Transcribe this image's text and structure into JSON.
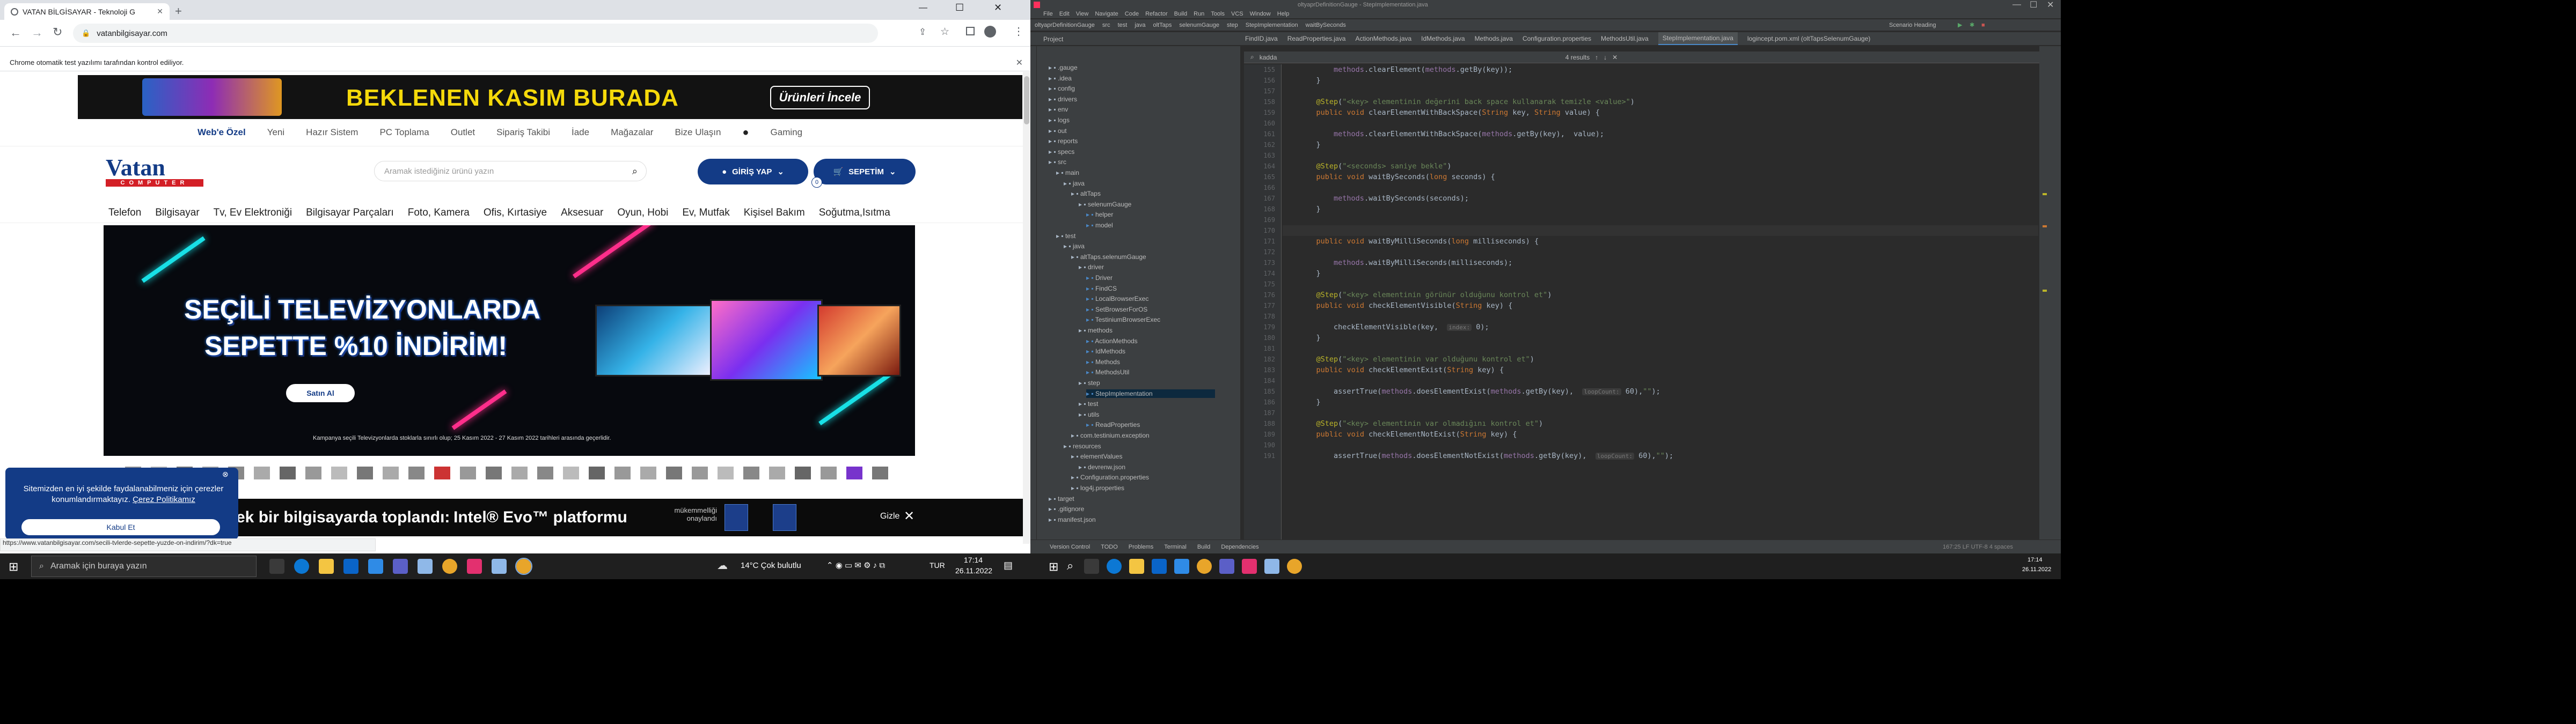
{
  "browser": {
    "tab_title": "VATAN BİLGİSAYAR - Teknoloji G",
    "url": "vatanbilgisayar.com",
    "infobar_text": "Chrome otomatik test yazılımı tarafından kontrol ediliyor.",
    "status_url": "https://www.vatanbilgisayar.com/secili-tvlerde-sepette-yuzde-on-indirim/?dk=true"
  },
  "site": {
    "top_banner_text": "BEKLENEN KASIM BURADA",
    "top_banner_button": "Ürünleri İncele",
    "top_nav": [
      "Web'e Özel",
      "Yeni",
      "Hazır Sistem",
      "PC Toplama",
      "Outlet",
      "Sipariş Takibi",
      "İade",
      "Mağazalar",
      "Bize Ulaşın",
      "Gaming"
    ],
    "logo_text": "Vatan",
    "logo_sub": "COMPUTER",
    "search_placeholder": "Aramak istediğiniz ürünü yazın",
    "login_label": "GİRİŞ YAP",
    "cart_label": "SEPETİM",
    "cart_count": "0",
    "categories": [
      "Telefon",
      "Bilgisayar",
      "Tv, Ev Elektroniği",
      "Bilgisayar Parçaları",
      "Foto, Kamera",
      "Ofis, Kırtasiye",
      "Aksesuar",
      "Oyun, Hobi",
      "Ev, Mutfak",
      "Kişisel Bakım",
      "Soğutma,Isıtma"
    ],
    "hero_line1": "SEÇİLİ TELEVİZYONLARDA",
    "hero_line2": "SEPETTE %10 İNDİRİM!",
    "hero_button": "Satın Al",
    "hero_footnote": "Kampanya seçili Televizyonlarda stoklarla sınırlı olup; 25 Kasım 2022 - 27 Kasım 2022 tarihleri arasında geçerlidir.",
    "cookie_text": "Sitemizden en iyi şekilde faydalanabilmeniz için çerezler konumlandırmaktayız.",
    "cookie_link": "Çerez Politikamız",
    "cookie_button": "Kabul Et",
    "intel_text_pre": "ek bir bilgisayarda toplandı:",
    "intel_text_brand": "Intel® Evo™ platformu",
    "intel_sub": "mükemmelliği onaylandı",
    "intel_close": "Gizle"
  },
  "ide": {
    "title": "oltyaprDefinitionGauge - StepImplementation.java",
    "menu": [
      "File",
      "Edit",
      "View",
      "Navigate",
      "Code",
      "Refactor",
      "Build",
      "Run",
      "Tools",
      "VCS",
      "Window",
      "Help"
    ],
    "breadcrumb": [
      "oltyaprDefinitionGauge",
      "src",
      "test",
      "java",
      "oltTaps",
      "selenumGauge",
      "step",
      "StepImplementation",
      "waitBySeconds"
    ],
    "run_config": "Scenario Heading",
    "tabs": [
      "FindID.java",
      "ReadProperties.java",
      "ActionMethods.java",
      "IdMethods.java",
      "Methods.java",
      "Configuration.properties",
      "MethodsUtil.java",
      "StepImplementation.java",
      "logincept.pom.xml (oltTapsSelenumGauge)"
    ],
    "find_text": "kadda",
    "find_count": "4 results",
    "project_label": "Project",
    "tree": [
      {
        "t": ".gauge",
        "d": 1
      },
      {
        "t": ".idea",
        "d": 1
      },
      {
        "t": "config",
        "d": 1
      },
      {
        "t": "drivers",
        "d": 1
      },
      {
        "t": "env",
        "d": 1
      },
      {
        "t": "logs",
        "d": 1
      },
      {
        "t": "out",
        "d": 1
      },
      {
        "t": "reports",
        "d": 1
      },
      {
        "t": "specs",
        "d": 1
      },
      {
        "t": "src",
        "d": 1
      },
      {
        "t": "main",
        "d": 2
      },
      {
        "t": "java",
        "d": 3
      },
      {
        "t": "altTaps",
        "d": 4
      },
      {
        "t": "selenumGauge",
        "d": 5
      },
      {
        "t": "helper",
        "d": 6
      },
      {
        "t": "model",
        "d": 6
      },
      {
        "t": "test",
        "d": 2
      },
      {
        "t": "java",
        "d": 3
      },
      {
        "t": "altTaps.selenumGauge",
        "d": 4
      },
      {
        "t": "driver",
        "d": 5
      },
      {
        "t": "Driver",
        "d": 6
      },
      {
        "t": "FindCS",
        "d": 6
      },
      {
        "t": "LocalBrowserExec",
        "d": 6
      },
      {
        "t": "SetBrowserForOS",
        "d": 6
      },
      {
        "t": "TestiniumBrowserExec",
        "d": 6
      },
      {
        "t": "methods",
        "d": 5
      },
      {
        "t": "ActionMethods",
        "d": 6
      },
      {
        "t": "IdMethods",
        "d": 6
      },
      {
        "t": "Methods",
        "d": 6
      },
      {
        "t": "MethodsUtil",
        "d": 6
      },
      {
        "t": "step",
        "d": 5
      },
      {
        "t": "StepImplementation",
        "d": 6
      },
      {
        "t": "test",
        "d": 5
      },
      {
        "t": "utils",
        "d": 5
      },
      {
        "t": "ReadProperties",
        "d": 6
      },
      {
        "t": "com.testinium.exception",
        "d": 4
      },
      {
        "t": "resources",
        "d": 3
      },
      {
        "t": "elementValues",
        "d": 4
      },
      {
        "t": "devrenw.json",
        "d": 5
      },
      {
        "t": "Configuration.properties",
        "d": 4
      },
      {
        "t": "log4j.properties",
        "d": 4
      },
      {
        "t": "target",
        "d": 1
      },
      {
        "t": ".gitignore",
        "d": 1
      },
      {
        "t": "manifest.json",
        "d": 1
      }
    ],
    "code_lines": [
      {
        "n": "155",
        "html": "        methods.clearElement(methods.getBy(key));"
      },
      {
        "n": "156",
        "html": "    }"
      },
      {
        "n": "157",
        "html": ""
      },
      {
        "n": "158",
        "html": "    @Step(\"<key> elementinin değerini back space kullanarak temizle <value>\")"
      },
      {
        "n": "159",
        "html": "    public void clearElementWithBackSpace(String key, String value) {"
      },
      {
        "n": "160",
        "html": ""
      },
      {
        "n": "161",
        "html": "        methods.clearElementWithBackSpace(methods.getBy(key),  value);"
      },
      {
        "n": "162",
        "html": "    }"
      },
      {
        "n": "163",
        "html": ""
      },
      {
        "n": "164",
        "html": "    @Step(\"<seconds> saniye bekle\")"
      },
      {
        "n": "165",
        "html": "    public void waitBySeconds(long seconds) {"
      },
      {
        "n": "166",
        "html": ""
      },
      {
        "n": "167",
        "html": "        methods.waitBySeconds(seconds);"
      },
      {
        "n": "168",
        "html": "    }"
      },
      {
        "n": "169",
        "html": ""
      },
      {
        "n": "170",
        "html": "    @Step(\"<milliseconds> milisaniye bekle\")"
      },
      {
        "n": "171",
        "html": "    public void waitByMilliSeconds(long milliseconds) {"
      },
      {
        "n": "172",
        "html": ""
      },
      {
        "n": "173",
        "html": "        methods.waitByMilliSeconds(milliseconds);"
      },
      {
        "n": "174",
        "html": "    }"
      },
      {
        "n": "175",
        "html": ""
      },
      {
        "n": "176",
        "html": "    @Step(\"<key> elementinin görünür olduğunu kontrol et\")"
      },
      {
        "n": "177",
        "html": "    public void checkElementVisible(String key) {"
      },
      {
        "n": "178",
        "html": ""
      },
      {
        "n": "179",
        "html": "        checkElementVisible(key,  index: 0);"
      },
      {
        "n": "180",
        "html": "    }"
      },
      {
        "n": "181",
        "html": ""
      },
      {
        "n": "182",
        "html": "    @Step(\"<key> elementinin var olduğunu kontrol et\")"
      },
      {
        "n": "183",
        "html": "    public void checkElementExist(String key) {"
      },
      {
        "n": "184",
        "html": ""
      },
      {
        "n": "185",
        "html": "        assertTrue(methods.doesElementExist(methods.getBy(key),  loopCount: 60),\"\");"
      },
      {
        "n": "186",
        "html": "    }"
      },
      {
        "n": "187",
        "html": ""
      },
      {
        "n": "188",
        "html": "    @Step(\"<key> elementinin var olmadığını kontrol et\")"
      },
      {
        "n": "189",
        "html": "    public void checkElementNotExist(String key) {"
      },
      {
        "n": "190",
        "html": ""
      },
      {
        "n": "191",
        "html": "        assertTrue(methods.doesElementNotExist(methods.getBy(key),  loopCount: 60),\"\");"
      }
    ],
    "bottom_tabs": [
      "Version Control",
      "TODO",
      "Problems",
      "Terminal",
      "Build",
      "Dependencies"
    ],
    "status_right": "167:25   LF   UTF-8   4 spaces"
  },
  "taskbar": {
    "search_placeholder": "Aramak için buraya yazın",
    "weather": "14°C  Çok bulutlu",
    "lang": "TUR",
    "time": "17:14",
    "date": "26.11.2022",
    "time2": "17:14",
    "date2": "26.11.2022"
  }
}
